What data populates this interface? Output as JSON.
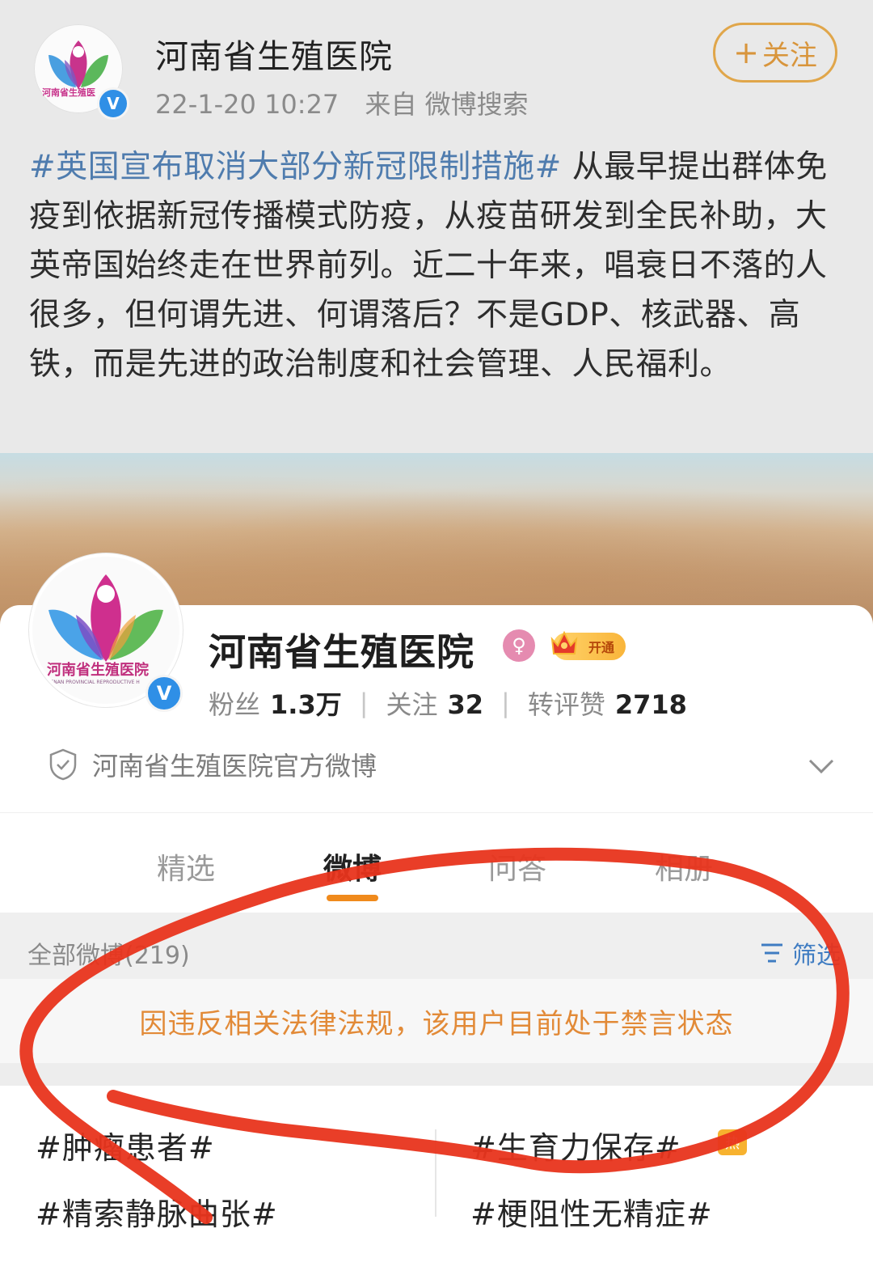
{
  "post": {
    "author": "河南省生殖医院",
    "follow_label": "关注",
    "time": "22-1-20 10:27",
    "source": "来自 微博搜索",
    "hashtag": "#英国宣布取消大部分新冠限制措施#",
    "text": " 从最早提出群体免疫到依据新冠传播模式防疫，从疫苗研发到全民补助，大英帝国始终走在世界前列。近二十年来，唱衰日不落的人很多，但何谓先进、何谓落后？不是GDP、核武器、高铁，而是先进的政治制度和社会管理、人民福利。"
  },
  "logo": {
    "small_text": "河南省生殖医",
    "large_text": "河南省生殖医院",
    "english_text": "HENAN PROVINCIAL REPRODUCTIVE H"
  },
  "profile": {
    "name": "河南省生殖医院",
    "vip_label": "开通",
    "fans_label": "粉丝",
    "fans_value": "1.3万",
    "following_label": "关注",
    "following_value": "32",
    "interactions_label": "转评赞",
    "interactions_value": "2718",
    "verified_text": "河南省生殖医院官方微博"
  },
  "tabs": [
    "精选",
    "微博",
    "问答",
    "相册"
  ],
  "feed": {
    "count_label": "全部微博(219)",
    "filter_label": "筛选",
    "banned_notice": "因违反相关法律法规，该用户目前处于禁言状态"
  },
  "topics": [
    "#肿瘤患者#",
    "#生育力保存#",
    "#精索静脉曲张#",
    "#梗阻性无精症#"
  ],
  "hot_badge": "热",
  "colors": {
    "accent_orange": "#f08a1c",
    "hashtag_blue": "#4f7cae",
    "verified_blue": "#2f8fe6",
    "annotation_red": "#e8341c"
  }
}
